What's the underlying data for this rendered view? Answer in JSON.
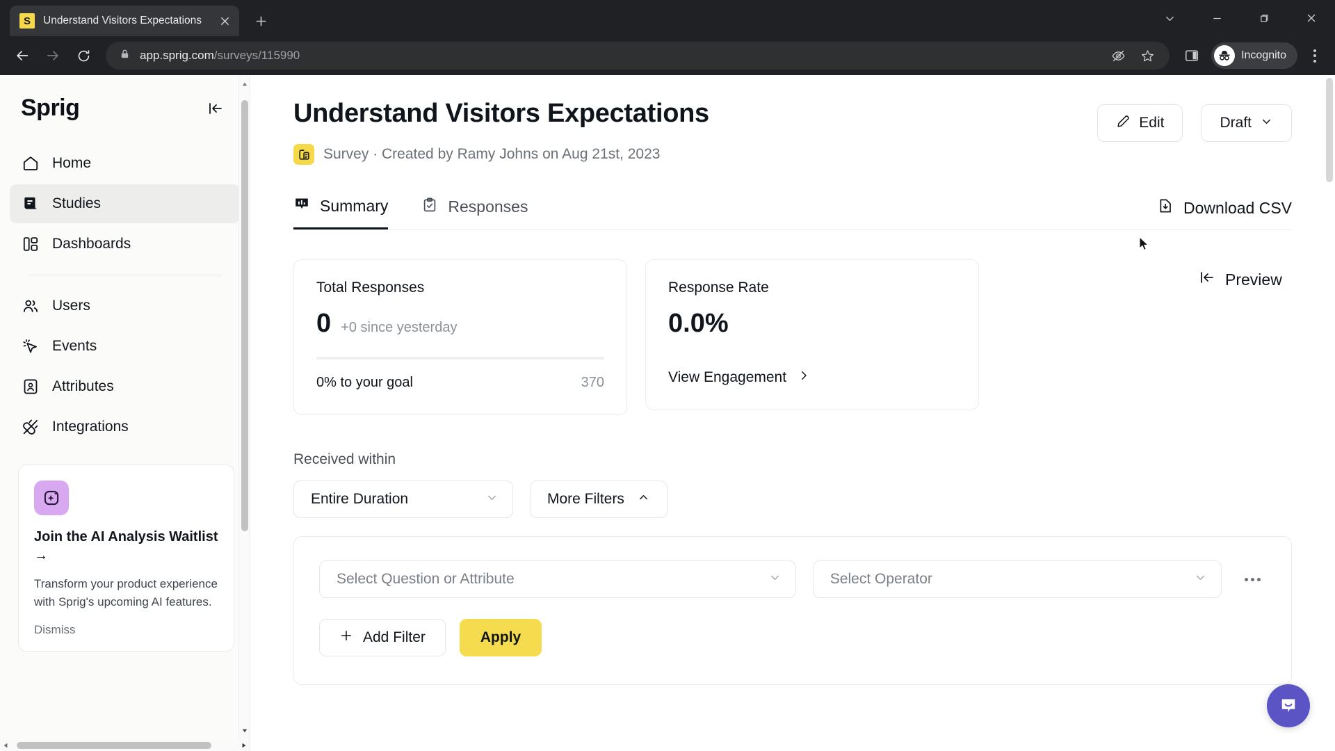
{
  "browser": {
    "tab": {
      "favicon_letter": "S",
      "title": "Understand Visitors Expectations",
      "close_icon": "close-icon"
    },
    "new_tab_icon": "plus-icon",
    "window": {
      "minimize": "minimize-icon",
      "maximize": "maximize-icon",
      "close": "window-close-icon",
      "chevron": "chevron-down-icon"
    },
    "nav": {
      "back": "back-arrow-icon",
      "forward": "forward-arrow-icon",
      "reload": "reload-icon"
    },
    "omnibox": {
      "lock_icon": "lock-icon",
      "domain": "app.sprig.com",
      "path": "/surveys/115990"
    },
    "toolbar_icons": {
      "tracking": "eye-slash-icon",
      "bookmark": "star-icon",
      "sidepanel": "side-panel-icon",
      "menu": "kebab-menu-icon"
    },
    "profile": {
      "label": "Incognito",
      "icon": "incognito-icon"
    }
  },
  "sidebar": {
    "logo": "Sprig",
    "collapse_icon": "collapse-panel-icon",
    "items": [
      {
        "label": "Home",
        "icon": "home-icon",
        "active": false
      },
      {
        "label": "Studies",
        "icon": "studies-icon",
        "active": true
      },
      {
        "label": "Dashboards",
        "icon": "dashboards-icon",
        "active": false
      },
      {
        "label": "Users",
        "icon": "users-icon",
        "active": false
      },
      {
        "label": "Events",
        "icon": "events-cursor-icon",
        "active": false
      },
      {
        "label": "Attributes",
        "icon": "attributes-id-icon",
        "active": false
      },
      {
        "label": "Integrations",
        "icon": "integrations-plug-icon",
        "active": false
      }
    ],
    "promo": {
      "icon": "ai-sparkle-icon",
      "title": "Join the AI Analysis Waitlist →",
      "body": "Transform your product experience with Sprig's upcoming AI features.",
      "dismiss": "Dismiss"
    }
  },
  "header": {
    "title": "Understand Visitors Expectations",
    "badge_icon": "survey-badge-icon",
    "subtitle": "Survey · Created by Ramy Johns on Aug 21st, 2023",
    "edit_button": {
      "label": "Edit",
      "icon": "pencil-icon"
    },
    "status_button": {
      "label": "Draft",
      "icon": "chevron-down-icon"
    }
  },
  "tabs": {
    "items": [
      {
        "label": "Summary",
        "icon": "summary-chart-icon",
        "active": true
      },
      {
        "label": "Responses",
        "icon": "clipboard-check-icon",
        "active": false
      }
    ],
    "download_csv": {
      "label": "Download CSV",
      "icon": "file-download-icon"
    }
  },
  "cards": {
    "total_responses": {
      "label": "Total Responses",
      "value": "0",
      "delta": "+0 since yesterday",
      "goal_text": "0% to your goal",
      "goal_value": "370",
      "progress_percent": 0
    },
    "response_rate": {
      "label": "Response Rate",
      "value": "0.0%",
      "link_label": "View Engagement",
      "link_icon": "chevron-right-icon"
    },
    "preview": {
      "label": "Preview",
      "icon": "preview-panel-icon"
    }
  },
  "filters": {
    "received_within_label": "Received within",
    "duration_value": "Entire Duration",
    "duration_icon": "chevron-down-icon",
    "more_filters": {
      "label": "More Filters",
      "icon": "chevron-up-icon"
    },
    "question_placeholder": "Select Question or Attribute",
    "operator_placeholder": "Select Operator",
    "row_menu_icon": "ellipsis-icon",
    "add_filter": {
      "label": "Add Filter",
      "icon": "plus-icon"
    },
    "apply": {
      "label": "Apply"
    }
  },
  "widgets": {
    "chat_icon": "chat-bubble-icon"
  },
  "colors": {
    "brand_yellow": "#F5D949",
    "apply_yellow": "#F5DC4E",
    "chat_purple": "#5b54c4",
    "promo_purple": "#d8a9f0",
    "text_dark": "#10151b",
    "text_muted": "#6b7177"
  }
}
